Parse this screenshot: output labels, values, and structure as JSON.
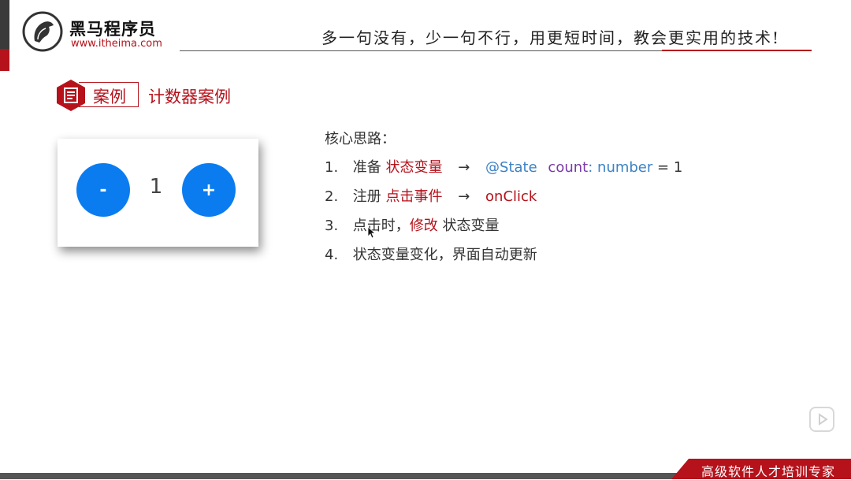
{
  "header": {
    "brand_name": "黑马程序员",
    "brand_url": "www.itheima.com",
    "slogan": "多一句没有，少一句不行，用更短时间，教会更实用的技术!"
  },
  "section": {
    "tag_label": "案例",
    "title": "计数器案例"
  },
  "counter": {
    "minus_label": "-",
    "value": "1",
    "plus_label": "+"
  },
  "ideas": {
    "title": "核心思路：",
    "items": [
      {
        "num": "1.",
        "pre": "准备",
        "key": "状态变量",
        "arrow": "→",
        "decorator": "@State",
        "ident": "count",
        "colon": ":",
        "type": "number",
        "assign": "= 1"
      },
      {
        "num": "2.",
        "pre": "注册",
        "key": "点击事件",
        "arrow": "→",
        "handler": "onClick"
      },
      {
        "num": "3.",
        "pre": "点击时，",
        "key": "修改",
        "post": "状态变量"
      },
      {
        "num": "4.",
        "text": "状态变量变化，界面自动更新"
      }
    ]
  },
  "footer": {
    "tag_text": "高级软件人才培训专家"
  },
  "colors": {
    "brand_red": "#b5121b",
    "button_blue": "#0a7cf0",
    "code_blue": "#3b82c6",
    "code_purple": "#7a3aa8"
  }
}
